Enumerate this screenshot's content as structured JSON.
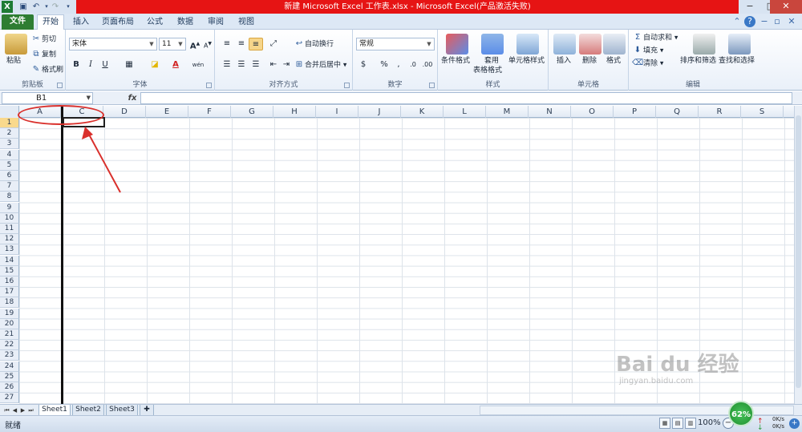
{
  "window": {
    "title": "新建 Microsoft Excel 工作表.xlsx - Microsoft Excel(产品激活失败)"
  },
  "ribbon_tabs": [
    "文件",
    "开始",
    "插入",
    "页面布局",
    "公式",
    "数据",
    "审阅",
    "视图"
  ],
  "clipboard": {
    "paste": "粘贴",
    "cut": "剪切",
    "copy": "复制",
    "format_painter": "格式刷",
    "label": "剪贴板"
  },
  "font": {
    "name": "宋体",
    "size": "11",
    "bold": "B",
    "italic": "I",
    "underline": "U",
    "phonetic": "wén",
    "label": "字体"
  },
  "alignment": {
    "wrap_text": "自动换行",
    "merge_center": "合并后居中",
    "label": "对齐方式"
  },
  "number": {
    "format": "常规",
    "percent": "%",
    "comma": ",",
    "label": "数字"
  },
  "styles": {
    "conditional_formatting": "条件格式",
    "format_as_table_line1": "套用",
    "format_as_table_line2": "表格格式",
    "cell_styles": "单元格样式",
    "label": "样式"
  },
  "cells_group": {
    "insert": "插入",
    "delete": "删除",
    "format": "格式",
    "label": "单元格"
  },
  "editing": {
    "autosum": "自动求和",
    "fill": "填充",
    "clear": "清除",
    "sort_filter": "排序和筛选",
    "find_select": "查找和选择",
    "label": "编辑"
  },
  "formula_bar": {
    "name_box": "B1",
    "fx": "fx",
    "value": ""
  },
  "columns": [
    "A",
    "C",
    "D",
    "E",
    "F",
    "G",
    "H",
    "I",
    "J",
    "K",
    "L",
    "M",
    "N",
    "O",
    "P",
    "Q",
    "R",
    "S"
  ],
  "rows": [
    "1",
    "2",
    "3",
    "4",
    "5",
    "6",
    "7",
    "8",
    "9",
    "10",
    "11",
    "12",
    "13",
    "14",
    "15",
    "16",
    "17",
    "18",
    "19",
    "20",
    "21",
    "22",
    "23",
    "24",
    "25",
    "26",
    "27"
  ],
  "active_row": "1",
  "sheets": [
    "Sheet1",
    "Sheet2",
    "Sheet3"
  ],
  "active_sheet": "Sheet1",
  "status": {
    "ready": "就绪",
    "zoom": "100%",
    "perf_badge": "62%",
    "net_up": "0K/s",
    "net_down": "0K/s"
  },
  "watermark": {
    "line1": "Bai du 经验",
    "line2": "jingyan.baidu.com"
  },
  "colors": {
    "title_band": "#e61414",
    "file_tab": "#2e7d32",
    "annotation": "#d9302c",
    "active_row_header": "#f9d98c"
  },
  "icons": {
    "app": "excel-logo-icon",
    "save": "save-icon",
    "undo": "undo-icon",
    "redo": "redo-icon",
    "help": "help-icon"
  }
}
